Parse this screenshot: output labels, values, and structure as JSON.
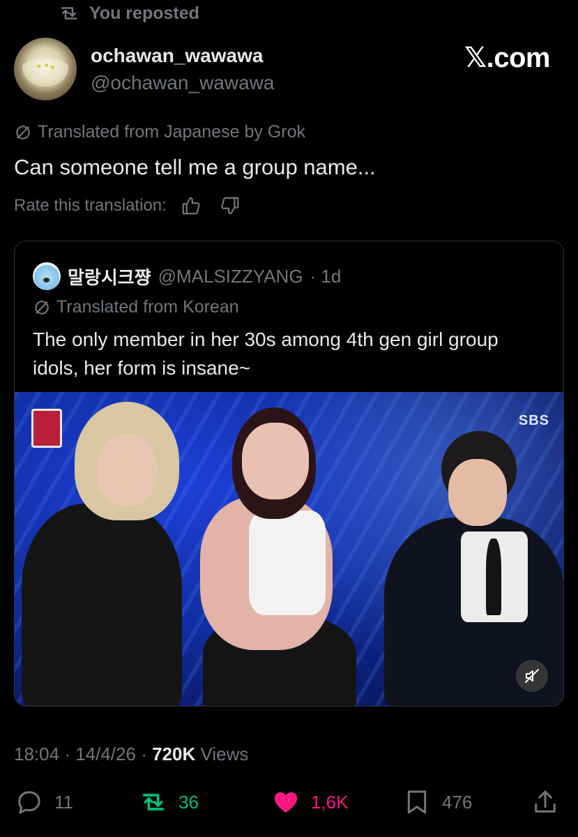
{
  "repost_banner": {
    "text": "You reposted"
  },
  "author": {
    "display_name": "ochawan_wawawa",
    "handle": "@ochawan_wawawa"
  },
  "site_label": "𝕏.com",
  "translation": {
    "note": "Translated from Japanese by Grok",
    "rate_label": "Rate this translation:"
  },
  "tweet": {
    "text": "Can someone tell me a group name..."
  },
  "quoted": {
    "display_name": "말랑시크쨩",
    "handle": "@MALSIZZYANG",
    "age": "· 1d",
    "translation_note": "Translated from Korean",
    "text": "The only member in her 30s among 4th gen girl group idols, her form is insane~",
    "media_logo": "SBS"
  },
  "meta": {
    "time": "18:04",
    "date": "14/4/26",
    "views_count": "720K",
    "views_label": "Views"
  },
  "actions": {
    "replies": "11",
    "reposts": "36",
    "likes": "1,6K",
    "bookmarks": "476"
  },
  "colors": {
    "repost_active": "#00ba7c",
    "like_active": "#f91880",
    "muted_text": "#71767b",
    "text": "#e7e9ea"
  }
}
